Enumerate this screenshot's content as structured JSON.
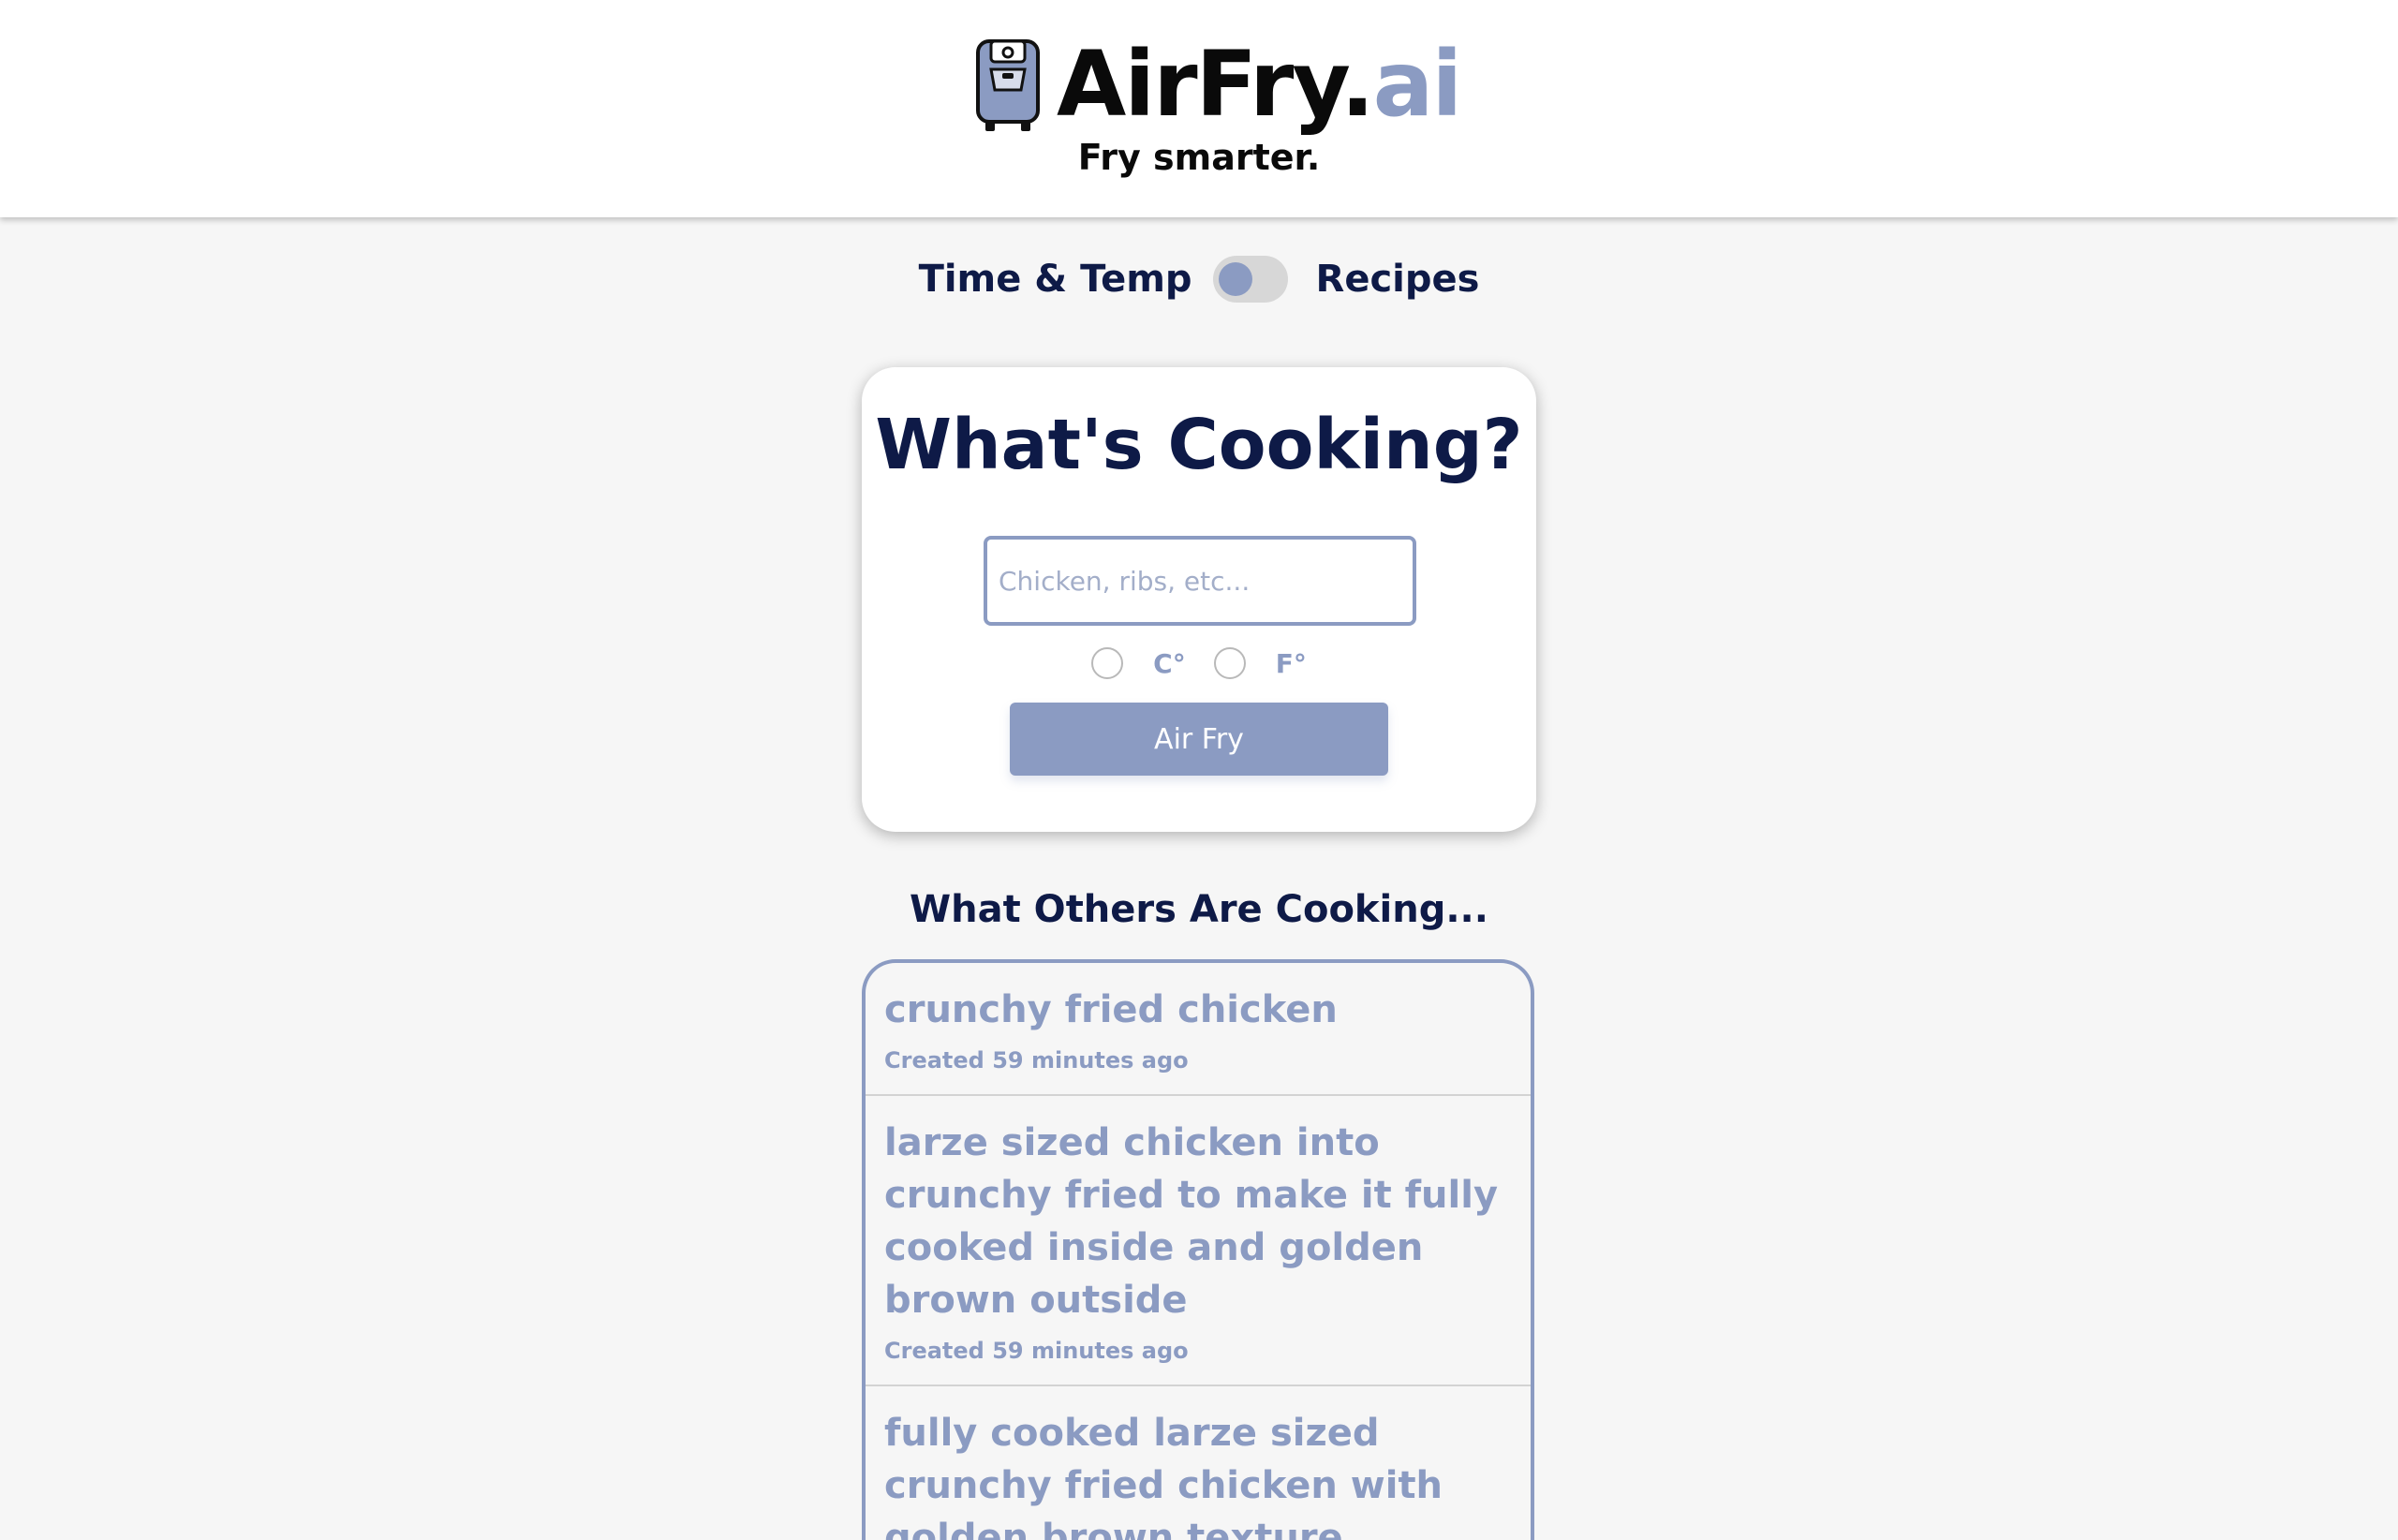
{
  "header": {
    "brand_main": "AirFry.",
    "brand_accent": "ai",
    "tagline": "Fry smarter.",
    "logo_icon": "air-fryer-icon"
  },
  "mode_toggle": {
    "left_label": "Time & Temp",
    "right_label": "Recipes",
    "selected": "Time & Temp"
  },
  "card": {
    "title": "What's Cooking?",
    "input": {
      "placeholder": "Chicken, ribs, etc...",
      "value": ""
    },
    "units": [
      {
        "label": "C°",
        "selected": false
      },
      {
        "label": "F°",
        "selected": false
      }
    ],
    "button_label": "Air Fry"
  },
  "others": {
    "title": "What Others Are Cooking...",
    "items": [
      {
        "title": "crunchy fried chicken",
        "meta": "Created 59 minutes ago"
      },
      {
        "title": "larze sized chicken into crunchy fried to make it fully cooked inside and golden brown outside",
        "meta": "Created 59 minutes ago"
      },
      {
        "title": "fully cooked larze sized crunchy fried chicken with golden brown texture",
        "meta": ""
      }
    ]
  },
  "colors": {
    "accent": "#8b9bc2",
    "navy": "#0e1a47",
    "background": "#f6f6f6",
    "header_bg": "#ffffff"
  }
}
